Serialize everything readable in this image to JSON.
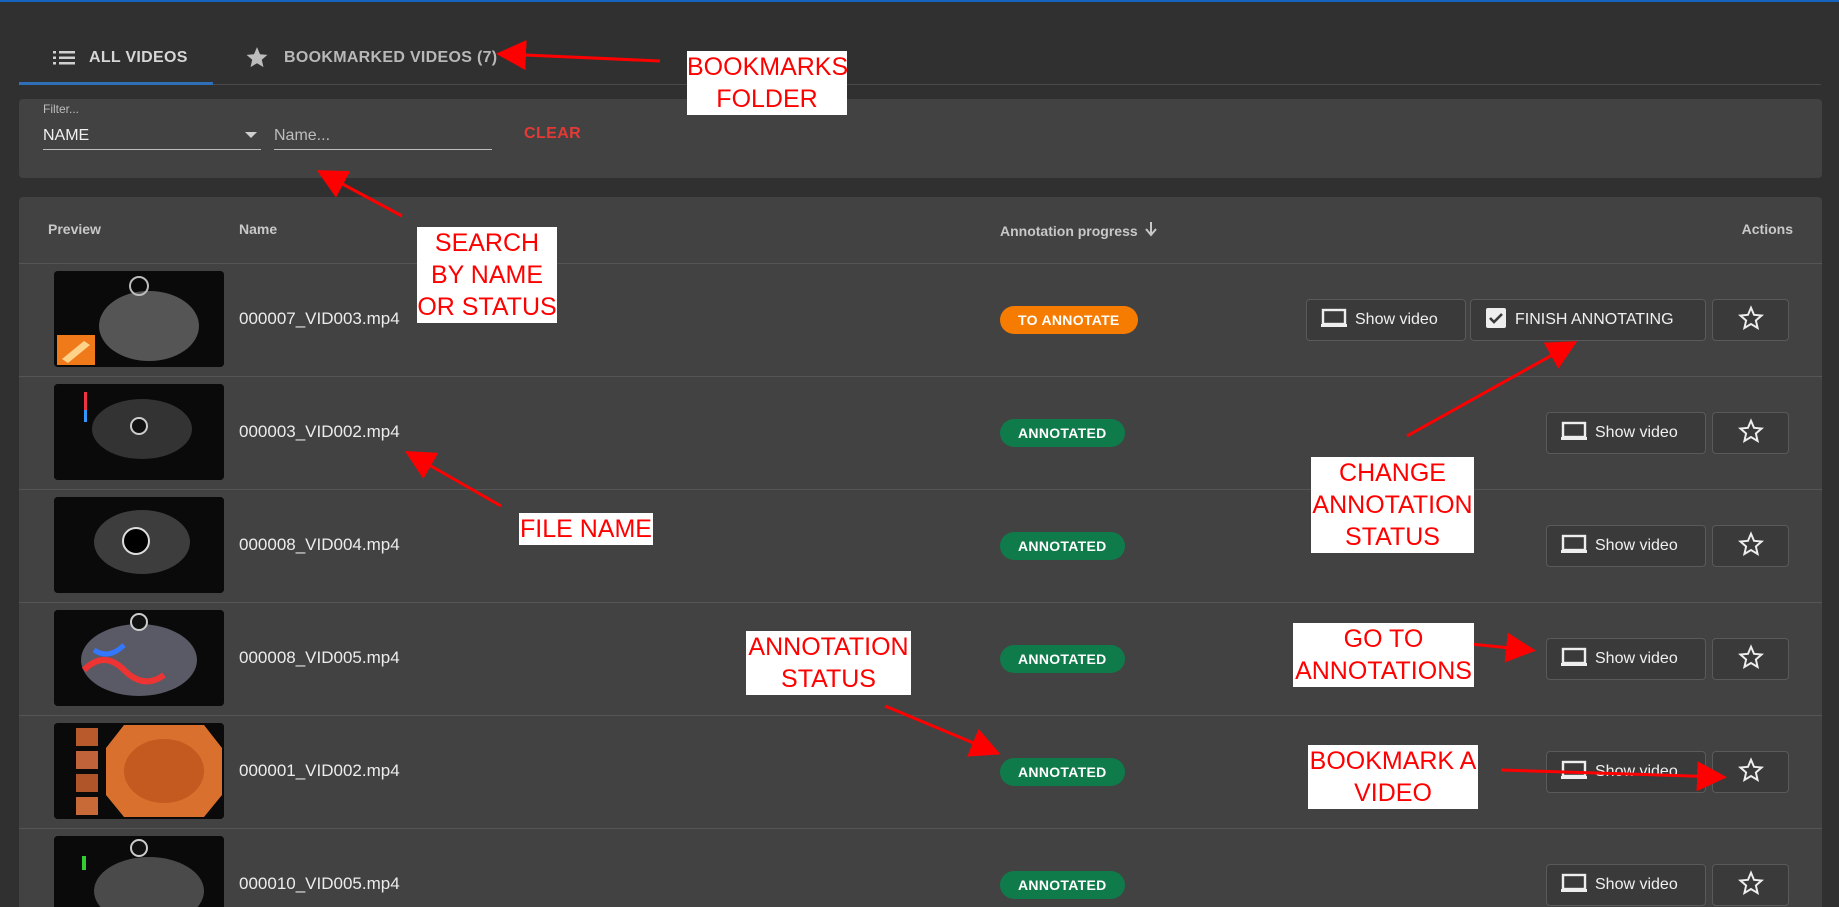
{
  "tabs": [
    {
      "label": "ALL VIDEOS",
      "icon": "list-icon"
    },
    {
      "label": "BOOKMARKED VIDEOS (7)",
      "icon": "star-filled-icon"
    }
  ],
  "filter": {
    "label": "Filter...",
    "selected": "NAME",
    "placeholder": "Name...",
    "clear_label": "CLEAR"
  },
  "table": {
    "headers": {
      "preview": "Preview",
      "name": "Name",
      "progress": "Annotation progress",
      "actions": "Actions"
    },
    "show_video_label": "Show video",
    "finish_label": "FINISH ANNOTATING",
    "rows": [
      {
        "name": "000007_VID003.mp4",
        "status": "TO ANNOTATE"
      },
      {
        "name": "000003_VID002.mp4",
        "status": "ANNOTATED"
      },
      {
        "name": "000008_VID004.mp4",
        "status": "ANNOTATED"
      },
      {
        "name": "000008_VID005.mp4",
        "status": "ANNOTATED"
      },
      {
        "name": "000001_VID002.mp4",
        "status": "ANNOTATED"
      },
      {
        "name": "000010_VID005.mp4",
        "status": "ANNOTATED"
      }
    ]
  },
  "annotations": {
    "bookmarks": "BOOKMARKS FOLDER",
    "search": "SEARCH BY NAME OR STATUS",
    "file_name": "FILE NAME",
    "change_status": "CHANGE ANNOTATION STATUS",
    "go_to": "GO TO ANNOTATIONS",
    "status": "ANNOTATION STATUS",
    "bookmark": "BOOKMARK A VIDEO"
  },
  "colors": {
    "background": "#303030",
    "panel": "#424242",
    "accent": "#2f6fb8",
    "clear": "#e53935",
    "to_annotate": "#f57c00",
    "annotated": "#0f7a4a",
    "annotation_text": "#ff0000"
  }
}
